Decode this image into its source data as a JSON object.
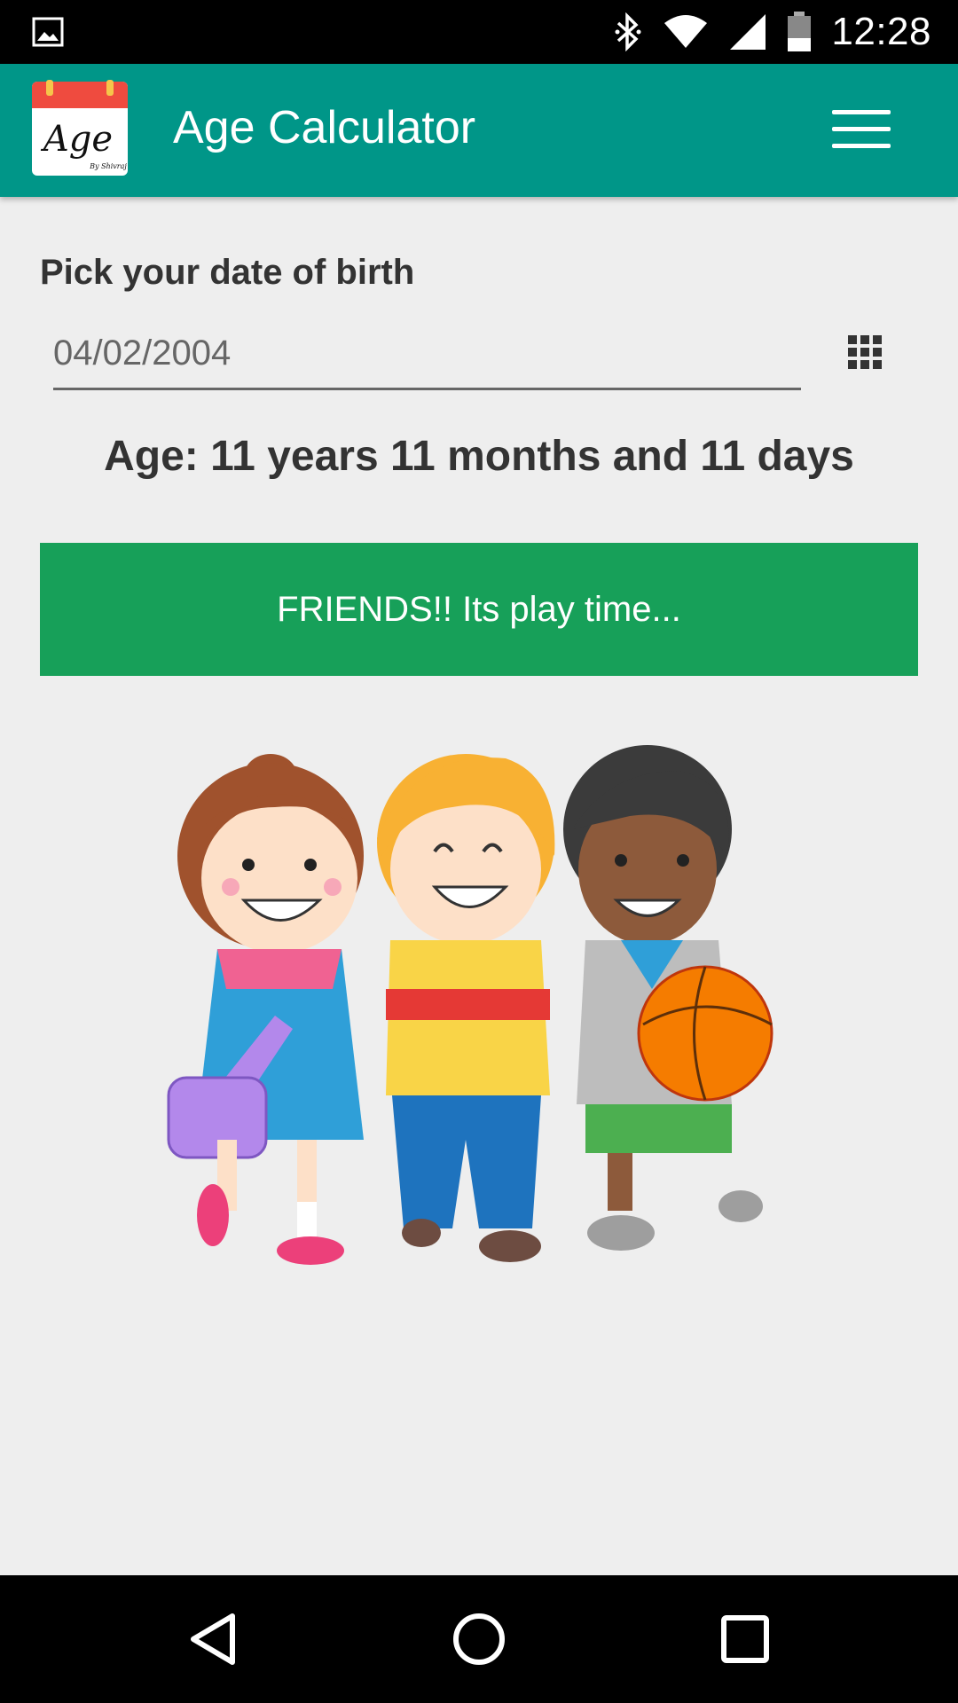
{
  "status_bar": {
    "time": "12:28",
    "icons": [
      "gallery-icon",
      "bluetooth-icon",
      "wifi-icon",
      "cell-signal-icon",
      "battery-icon"
    ]
  },
  "app_bar": {
    "logo_text": "Age",
    "logo_subtext": "By Shivraj",
    "title": "Age Calculator",
    "menu_icon": "hamburger-menu-icon",
    "background_color": "#009688"
  },
  "form": {
    "dob_label": "Pick your date of birth",
    "date_value": "04/02/2004",
    "calendar_icon": "calendar-grid-icon"
  },
  "result": {
    "age_text": "Age: 11 years 11 months and 11 days"
  },
  "message_button": {
    "label": "FRIENDS!! Its play time...",
    "color": "#17a059"
  },
  "nav_bar": {
    "icons": [
      "back-icon",
      "home-icon",
      "recents-icon"
    ]
  }
}
